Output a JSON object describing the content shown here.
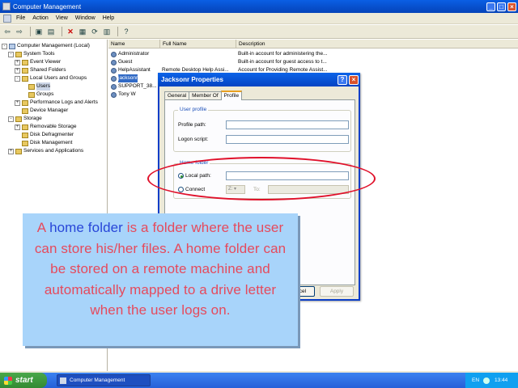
{
  "window": {
    "title": "Computer Management"
  },
  "menu": [
    "File",
    "Action",
    "View",
    "Window",
    "Help"
  ],
  "tree": [
    {
      "label": "Computer Management (Local)",
      "indent": 0,
      "exp": "-"
    },
    {
      "label": "System Tools",
      "indent": 1,
      "exp": "-"
    },
    {
      "label": "Event Viewer",
      "indent": 2,
      "exp": "+"
    },
    {
      "label": "Shared Folders",
      "indent": 2,
      "exp": "+"
    },
    {
      "label": "Local Users and Groups",
      "indent": 2,
      "exp": "-"
    },
    {
      "label": "Users",
      "indent": 3,
      "exp": "",
      "selected": true
    },
    {
      "label": "Groups",
      "indent": 3,
      "exp": ""
    },
    {
      "label": "Performance Logs and Alerts",
      "indent": 2,
      "exp": "+"
    },
    {
      "label": "Device Manager",
      "indent": 2,
      "exp": ""
    },
    {
      "label": "Storage",
      "indent": 1,
      "exp": "-"
    },
    {
      "label": "Removable Storage",
      "indent": 2,
      "exp": "+"
    },
    {
      "label": "Disk Defragmenter",
      "indent": 2,
      "exp": ""
    },
    {
      "label": "Disk Management",
      "indent": 2,
      "exp": ""
    },
    {
      "label": "Services and Applications",
      "indent": 1,
      "exp": "+"
    }
  ],
  "list": {
    "columns": [
      "Name",
      "Full Name",
      "Description"
    ],
    "rows": [
      {
        "name": "Administrator",
        "full": "",
        "desc": "Built-in account for administering the..."
      },
      {
        "name": "Guest",
        "full": "",
        "desc": "Built-in account for guest access to t..."
      },
      {
        "name": "HelpAssistant",
        "full": "Remote Desktop Help Assi...",
        "desc": "Account for Providing Remote Assist..."
      },
      {
        "name": "jacksonr",
        "full": "",
        "desc": "",
        "selected": true
      },
      {
        "name": "SUPPORT_38...",
        "full": "",
        "desc": ""
      },
      {
        "name": "Tony W",
        "full": "",
        "desc": ""
      }
    ]
  },
  "dialog": {
    "title": "Jacksonr Properties",
    "tabs": [
      "General",
      "Member Of",
      "Profile"
    ],
    "active_tab": "Profile",
    "user_profile_caption": "User profile",
    "profile_path_label": "Profile path:",
    "logon_script_label": "Logon script:",
    "home_folder_caption": "Home folder",
    "local_path_label": "Local path:",
    "connect_label": "Connect",
    "drive_value": "Z:",
    "to_label": "To:",
    "cancel_label": "Cancel",
    "apply_label": "Apply"
  },
  "callout": {
    "before": "A ",
    "highlight": "home folder",
    "after": " is a folder where the user can store his/her files. A home folder can be stored on a remote machine and automatically mapped to a drive letter when the user logs on."
  },
  "taskbar": {
    "start_label": "start",
    "task_label": "Computer Management",
    "language": "EN",
    "clock": "13:44"
  },
  "colors": {
    "highlight_ellipse": "#e0102a",
    "callout_bg": "#a8d4fa",
    "callout_text": "#e64a5c",
    "callout_highlight": "#2846d8"
  }
}
